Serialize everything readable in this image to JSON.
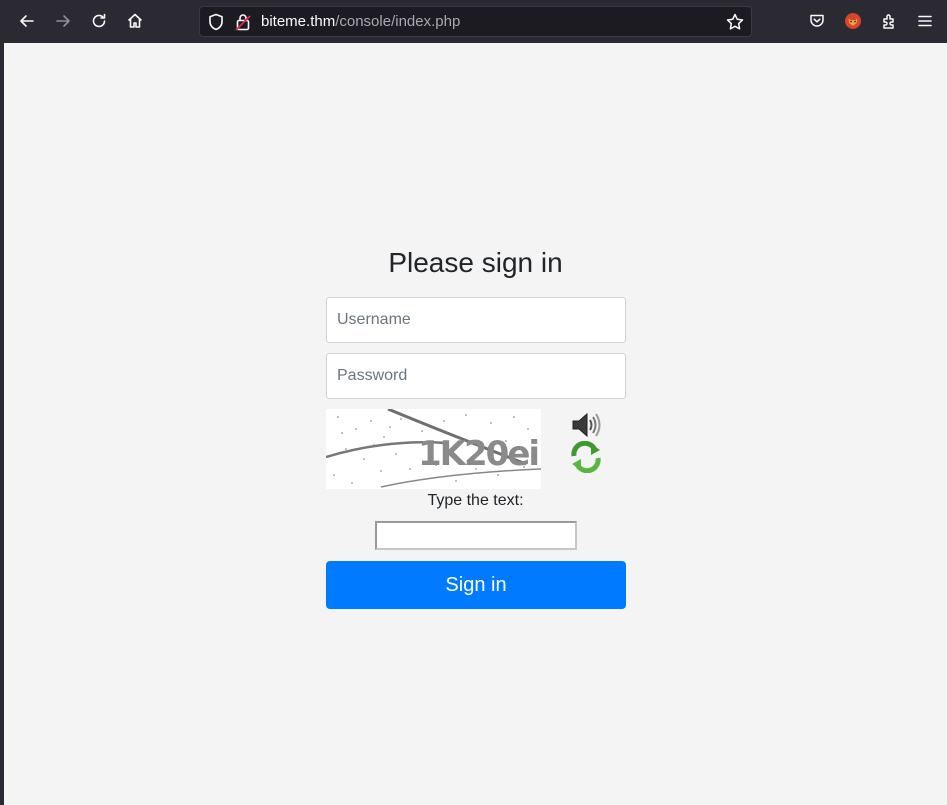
{
  "browser": {
    "url_host": "biteme.thm",
    "url_path": "/console/index.php",
    "icons": [
      "back-icon",
      "forward-icon",
      "reload-icon",
      "home-icon",
      "shield-icon",
      "lock-icon",
      "bookmark-star-icon",
      "pocket-icon",
      "extension-fox-icon",
      "extensions-icon",
      "menu-icon"
    ]
  },
  "form": {
    "heading": "Please sign in",
    "username_placeholder": "Username",
    "password_placeholder": "Password",
    "captcha_text": "1K20ei",
    "captcha_label": "Type the text:",
    "submit_label": "Sign in"
  },
  "colors": {
    "accent": "#007bff",
    "page_background": "#f4f4f4",
    "browser_chrome": "#2b2a33"
  }
}
